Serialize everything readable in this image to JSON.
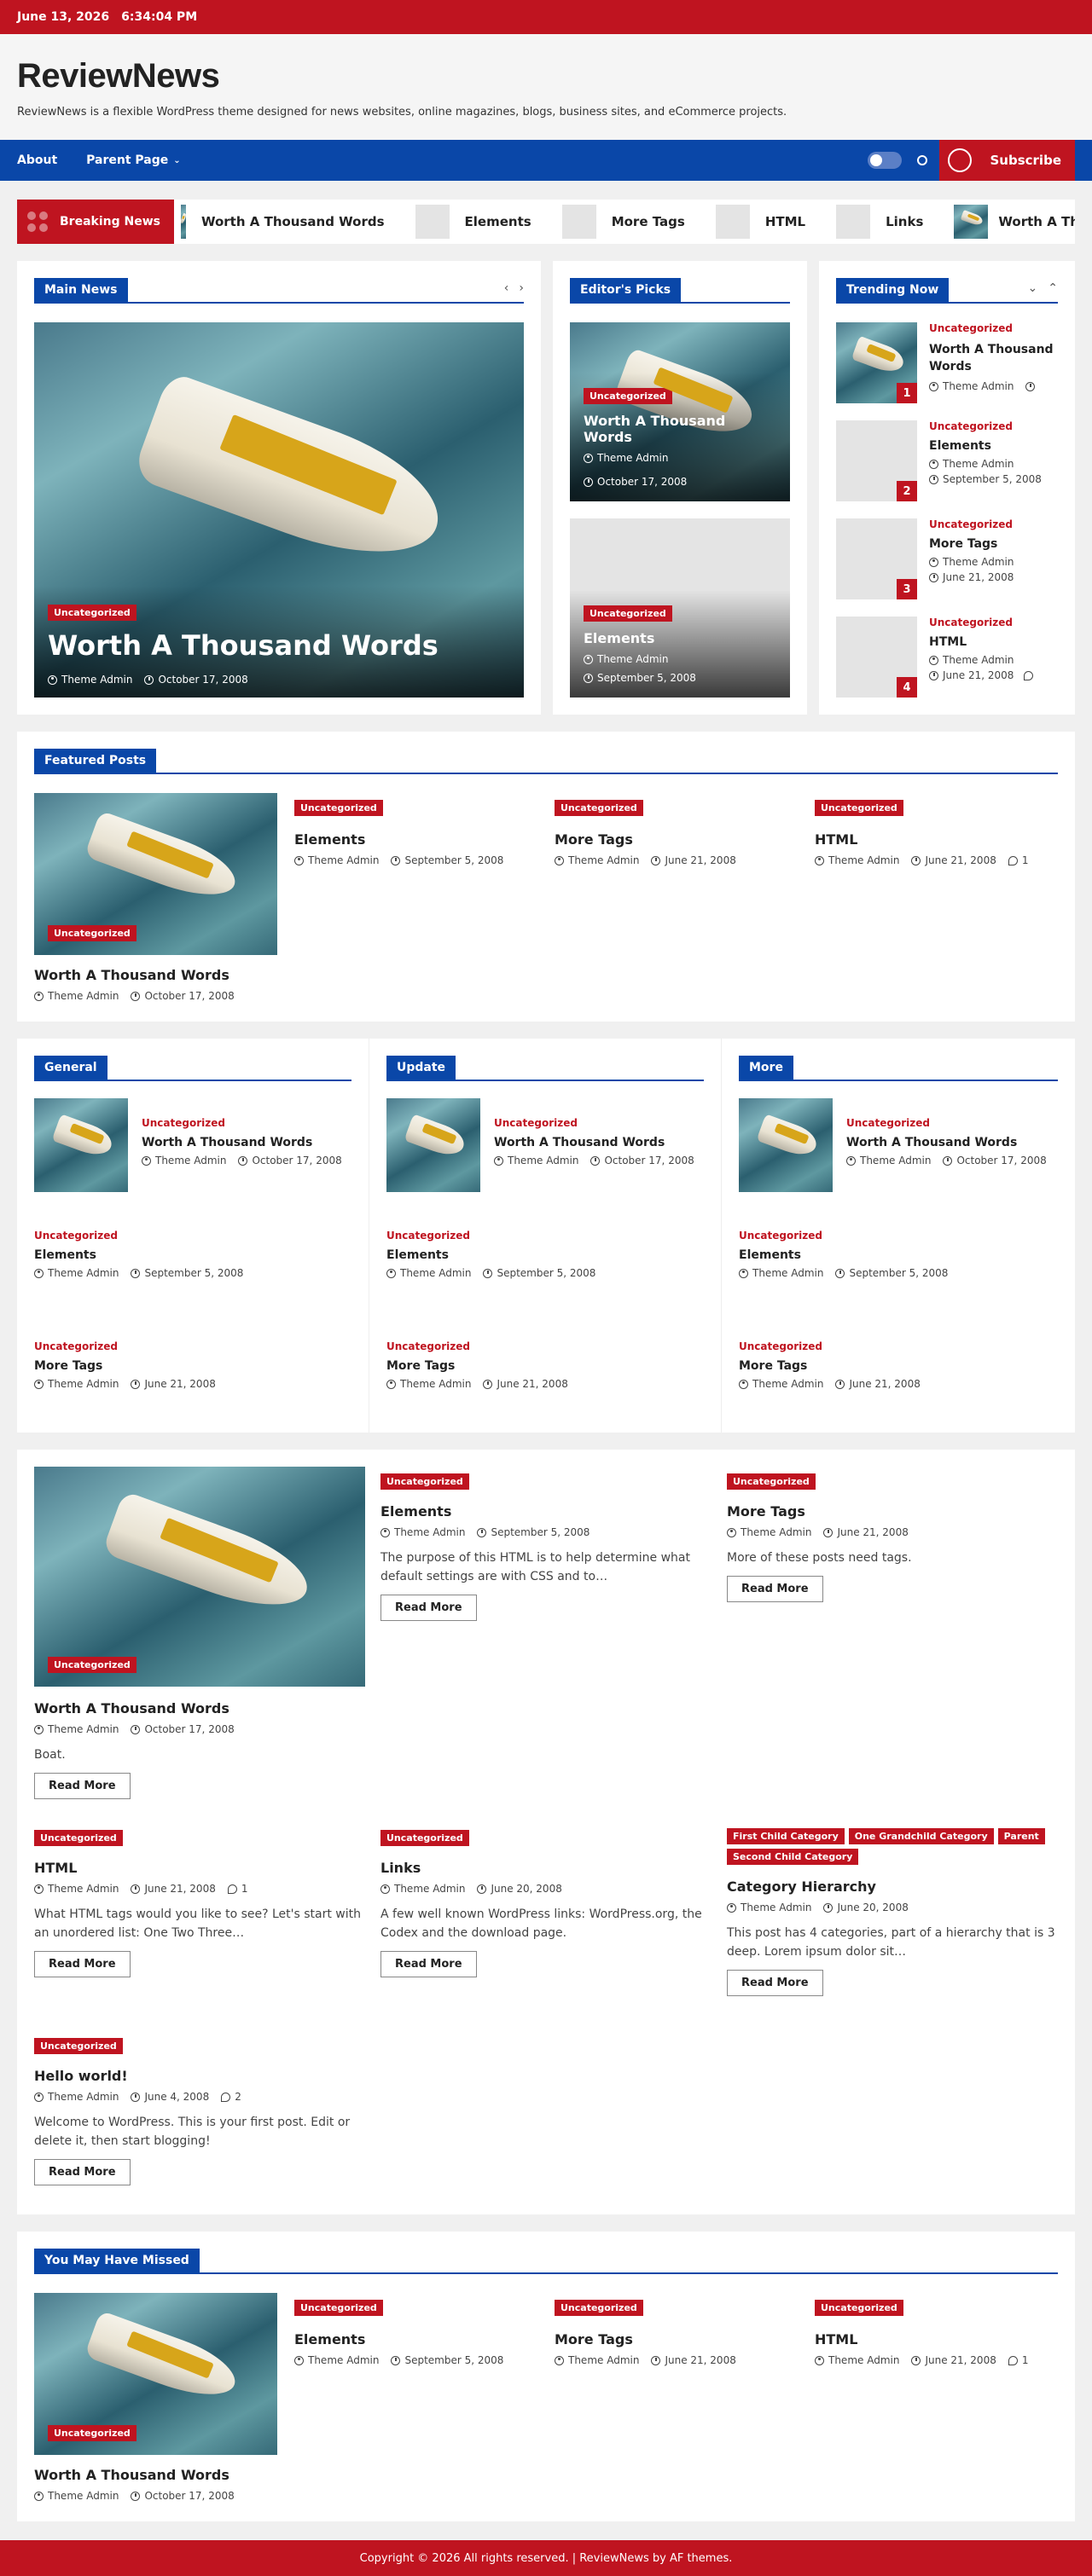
{
  "topbar": {
    "date": "June 13, 2026",
    "time": "6:34:04 PM"
  },
  "site": {
    "title": "ReviewNews",
    "description": "ReviewNews is a flexible WordPress theme designed for news websites, online magazines, blogs, business sites, and eCommerce projects."
  },
  "nav": {
    "items": [
      "About",
      "Parent Page"
    ],
    "subscribe": "Subscribe"
  },
  "breaking": {
    "label": "Breaking News",
    "items": [
      "Worth A Thousand Words",
      "Elements",
      "More Tags",
      "HTML",
      "Links",
      "Worth A Thousand Words"
    ]
  },
  "main_news": {
    "heading": "Main News",
    "category": "Uncategorized",
    "title": "Worth A Thousand Words",
    "author": "Theme Admin",
    "date": "October 17, 2008"
  },
  "editors_picks": {
    "heading": "Editor's Picks",
    "items": [
      {
        "category": "Uncategorized",
        "title": "Worth A Thousand Words",
        "author": "Theme Admin",
        "date": "October 17, 2008"
      },
      {
        "category": "Uncategorized",
        "title": "Elements",
        "author": "Theme Admin",
        "date": "September 5, 2008"
      }
    ]
  },
  "trending": {
    "heading": "Trending Now",
    "items": [
      {
        "num": "1",
        "category": "Uncategorized",
        "title": "Worth A Thousand Words",
        "author": "Theme Admin",
        "date": ""
      },
      {
        "num": "2",
        "category": "Uncategorized",
        "title": "Elements",
        "author": "Theme Admin",
        "date": "September 5, 2008"
      },
      {
        "num": "3",
        "category": "Uncategorized",
        "title": "More Tags",
        "author": "Theme Admin",
        "date": "June 21, 2008"
      },
      {
        "num": "4",
        "category": "Uncategorized",
        "title": "HTML",
        "author": "Theme Admin",
        "date": "June 21, 2008"
      }
    ]
  },
  "featured": {
    "heading": "Featured Posts",
    "items": [
      {
        "category": "Uncategorized",
        "title": "Worth A Thousand Words",
        "author": "Theme Admin",
        "date": "October 17, 2008"
      },
      {
        "category": "Uncategorized",
        "title": "Elements",
        "author": "Theme Admin",
        "date": "September 5, 2008"
      },
      {
        "category": "Uncategorized",
        "title": "More Tags",
        "author": "Theme Admin",
        "date": "June 21, 2008"
      },
      {
        "category": "Uncategorized",
        "title": "HTML",
        "author": "Theme Admin",
        "date": "June 21, 2008",
        "comments": "1"
      }
    ]
  },
  "columns": [
    {
      "heading": "General",
      "posts": [
        {
          "category": "Uncategorized",
          "title": "Worth A Thousand Words",
          "author": "Theme Admin",
          "date": "October 17, 2008"
        },
        {
          "category": "Uncategorized",
          "title": "Elements",
          "author": "Theme Admin",
          "date": "September 5, 2008"
        },
        {
          "category": "Uncategorized",
          "title": "More Tags",
          "author": "Theme Admin",
          "date": "June 21, 2008"
        }
      ]
    },
    {
      "heading": "Update",
      "posts": [
        {
          "category": "Uncategorized",
          "title": "Worth A Thousand Words",
          "author": "Theme Admin",
          "date": "October 17, 2008"
        },
        {
          "category": "Uncategorized",
          "title": "Elements",
          "author": "Theme Admin",
          "date": "September 5, 2008"
        },
        {
          "category": "Uncategorized",
          "title": "More Tags",
          "author": "Theme Admin",
          "date": "June 21, 2008"
        }
      ]
    },
    {
      "heading": "More",
      "posts": [
        {
          "category": "Uncategorized",
          "title": "Worth A Thousand Words",
          "author": "Theme Admin",
          "date": "October 17, 2008"
        },
        {
          "category": "Uncategorized",
          "title": "Elements",
          "author": "Theme Admin",
          "date": "September 5, 2008"
        },
        {
          "category": "Uncategorized",
          "title": "More Tags",
          "author": "Theme Admin",
          "date": "June 21, 2008"
        }
      ]
    }
  ],
  "grid": {
    "read_more": "Read More",
    "posts": [
      {
        "categories": [
          "Uncategorized"
        ],
        "title": "Worth A Thousand Words",
        "author": "Theme Admin",
        "date": "October 17, 2008",
        "excerpt": "Boat."
      },
      {
        "categories": [
          "Uncategorized"
        ],
        "title": "Elements",
        "author": "Theme Admin",
        "date": "September 5, 2008",
        "excerpt": "The purpose of this HTML is to help determine what default settings are with CSS and to…"
      },
      {
        "categories": [
          "Uncategorized"
        ],
        "title": "More Tags",
        "author": "Theme Admin",
        "date": "June 21, 2008",
        "excerpt": "More of these posts need tags."
      },
      {
        "categories": [
          "Uncategorized"
        ],
        "title": "HTML",
        "author": "Theme Admin",
        "date": "June 21, 2008",
        "comments": "1",
        "excerpt": "What HTML tags would you like to see? Let's start with an unordered list: One Two Three…"
      },
      {
        "categories": [
          "Uncategorized"
        ],
        "title": "Links",
        "author": "Theme Admin",
        "date": "June 20, 2008",
        "excerpt": "A few well known WordPress links: WordPress.org, the Codex and the download page."
      },
      {
        "categories": [
          "First Child Category",
          "One Grandchild Category",
          "Parent",
          "Second Child Category"
        ],
        "title": "Category Hierarchy",
        "author": "Theme Admin",
        "date": "June 20, 2008",
        "excerpt": "This post has 4 categories, part of a hierarchy that is 3 deep. Lorem ipsum dolor sit…"
      },
      {
        "categories": [
          "Uncategorized"
        ],
        "title": "Hello world!",
        "author": "Theme Admin",
        "date": "June 4, 2008",
        "comments": "2",
        "excerpt": "Welcome to WordPress. This is your first post. Edit or delete it, then start blogging!"
      }
    ]
  },
  "missed": {
    "heading": "You May Have Missed",
    "items": [
      {
        "category": "Uncategorized",
        "title": "Worth A Thousand Words",
        "author": "Theme Admin",
        "date": "October 17, 2008"
      },
      {
        "category": "Uncategorized",
        "title": "Elements",
        "author": "Theme Admin",
        "date": "September 5, 2008"
      },
      {
        "category": "Uncategorized",
        "title": "More Tags",
        "author": "Theme Admin",
        "date": "June 21, 2008"
      },
      {
        "category": "Uncategorized",
        "title": "HTML",
        "author": "Theme Admin",
        "date": "June 21, 2008",
        "comments": "1"
      }
    ]
  },
  "footer": {
    "text": "Copyright © 2026 All rights reserved. | ReviewNews by AF themes."
  },
  "colors": {
    "brand_red": "#bf1420",
    "brand_blue": "#0a47a8"
  },
  "icons": [
    "user-icon",
    "clock-icon",
    "comment-icon",
    "search-icon",
    "chevron-down-icon",
    "chevron-left-icon",
    "chevron-right-icon",
    "chevron-up-icon"
  ]
}
